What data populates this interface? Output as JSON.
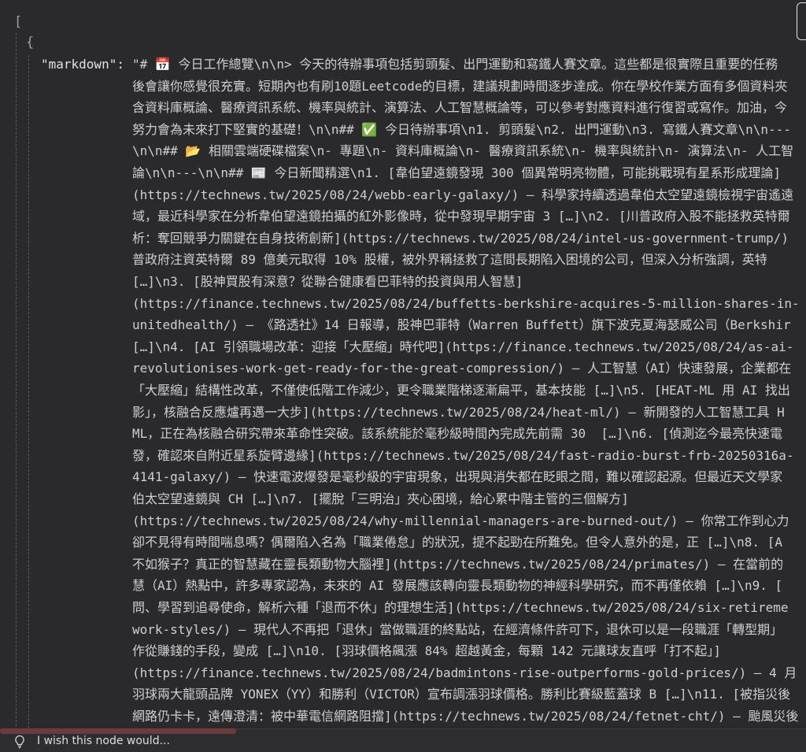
{
  "json_view": {
    "open_bracket": "[",
    "open_brace": "{",
    "key": "\"markdown\":",
    "value_lines": [
      "\"# 📅 今日工作總覽\\n\\n> 今天的待辦事項包括剪頭髮、出門運動和寫鐵人賽文章。這些都是很實際且重要的任務",
      "後會讓你感覺很充實。短期內也有刷10題Leetcode的目標，建議規劃時間逐步達成。你在學校作業方面有多個資料夾",
      "含資料庫概論、醫療資訊系統、機率與統計、演算法、人工智慧概論等，可以參考對應資料進行復習或寫作。加油，今",
      "努力會為未來打下堅實的基礎！\\n\\n## ✅ 今日待辦事項\\n1. 剪頭髮\\n2. 出門運動\\n3. 寫鐵人賽文章\\n\\n---",
      "\\n\\n## 📂 相關雲端硬碟檔案\\n- 專題\\n- 資料庫概論\\n- 醫療資訊系統\\n- 機率與統計\\n- 演算法\\n- 人工智",
      "論\\n\\n---\\n\\n## 📰 今日新聞精選\\n1. [韋伯望遠鏡發現 300 個異常明亮物體，可能挑戰現有星系形成理論]",
      "(https://technews.tw/2025/08/24/webb-early-galaxy/) — 科學家持續透過韋伯太空望遠鏡檢視宇宙遙遠",
      "域，最近科學家在分析韋伯望遠鏡拍攝的紅外影像時，從中發現早期宇宙 3 […]\\n2. [川普政府入股不能拯救英特爾",
      "析：奪回競爭力關鍵在自身技術創新](https://technews.tw/2025/08/24/intel-us-government-trump/)",
      "普政府注資英特爾 89 億美元取得 10% 股權，被外界稱拯救了這間長期陷入困境的公司，但深入分析強調，英特",
      "[…]\\n3. [股神買股有深意？從聯合健康看巴菲特的投資與用人智慧]",
      "(https://finance.technews.tw/2025/08/24/buffetts-berkshire-acquires-5-million-shares-in-",
      "unitedhealth/) — 《路透社》14 日報導，股神巴菲特（Warren Buffett）旗下波克夏海瑟威公司（Berkshir",
      "[…]\\n4. [AI 引領職場改革：迎接「大壓縮」時代吧](https://finance.technews.tw/2025/08/24/as-ai-",
      "revolutionises-work-get-ready-for-the-great-compression/) — 人工智慧（AI）快速發展，企業都在",
      "「大壓縮」結構性改革，不僅使低階工作減少，更令職業階梯逐漸扁平，基本技能 […]\\n5. [HEAT-ML 用 AI 找出",
      "影」，核融合反應爐再邁一大步](https://technews.tw/2025/08/24/heat-ml/) — 新開發的人工智慧工具 H",
      "ML，正在為核融合研究帶來革命性突破。該系統能於毫秒級時間內完成先前需 30  […]\\n6. [偵測迄今最亮快速電",
      "發，確認來自附近星系旋臂邊緣](https://technews.tw/2025/08/24/fast-radio-burst-frb-20250316a-",
      "4141-galaxy/) — 快速電波爆發是毫秒級的宇宙現象，出現與消失都在眨眼之間，難以確認起源。但最近天文學家",
      "伯太空望遠鏡與 CH […]\\n7. [擺脫「三明治」夾心困境，給心累中階主管的三個解方]",
      "(https://technews.tw/2025/08/24/why-millennial-managers-are-burned-out/) — 你常工作到心力",
      "卻不見得有時間喘息嗎？偶爾陷入名為「職業倦怠」的狀況，提不起勁在所難免。但令人意外的是，正 […]\\n8. [A",
      "不如猴子？真正的智慧藏在靈長類動物大腦裡](https://technews.tw/2025/08/24/primates/) — 在當前的",
      "慧（AI）熱點中，許多專家認為，未來的 AI 發展應該轉向靈長類動物的神經科學研究，而不再僅依賴 […]\\n9. [",
      "問、學習到追尋使命，解析六種「退而不休」的理想生活](https://technews.tw/2025/08/24/six-retireme",
      "work-styles/) — 現代人不再把「退休」當做職涯的終點站，在經濟條件許可下，退休可以是一段職涯「轉型期」",
      "作從賺錢的手段，變成 […]\\n10. [羽球價格飆漲 84% 超越黃金，每顆 142 元讓球友直呼「打不起」]",
      "(https://finance.technews.tw/2025/08/24/badmintons-rise-outperforms-gold-prices/) — 4 月",
      "羽球兩大龍頭品牌 YONEX（YY）和勝利（VICTOR）宣布調漲羽球價格。勝利比賽級藍蓋球 B […]\\n11. [被指災後",
      "網路仍卡卡，遠傳澄清：被中華電信網路阻擋](https://technews.tw/2025/08/24/fetnet-cht/) — 颱風災後"
    ]
  },
  "feedback": {
    "icon": "lightbulb-icon",
    "placeholder": "I wish this node would..."
  },
  "colors": {
    "background": "#2a2a2d",
    "text": "#cfcfcf",
    "scroll_thumb": "#6b3b3e"
  }
}
